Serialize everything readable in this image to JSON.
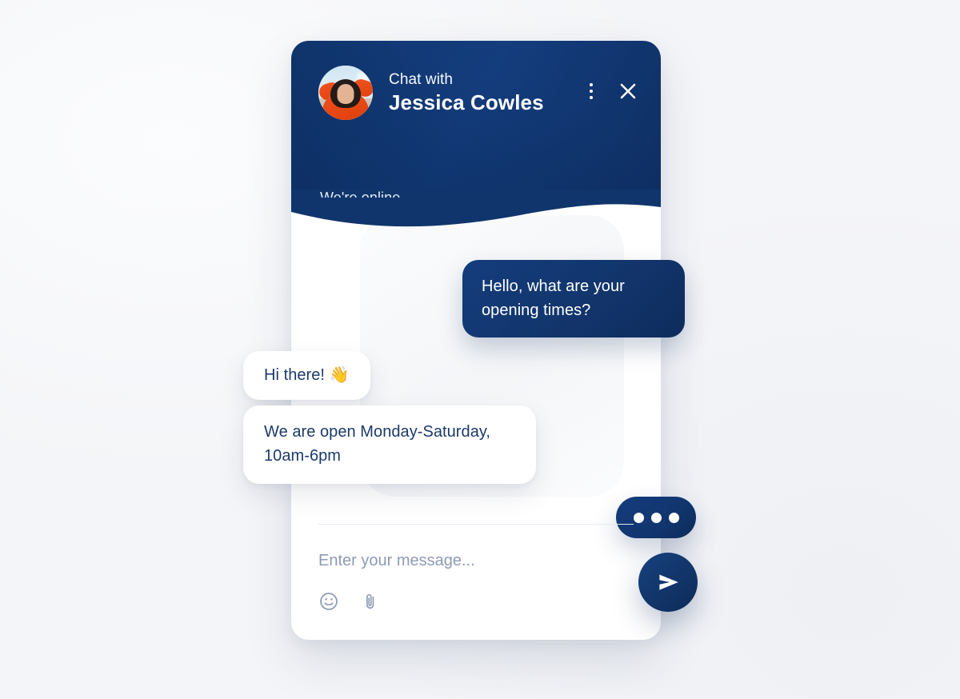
{
  "theme": {
    "page_background": "#f4f5f8",
    "brand_navy": "#143d7d",
    "brand_navy_dark": "#0d2b59",
    "agent_text": "#1c3a6b",
    "muted_text": "#8d9ab4",
    "bubble_white": "#ffffff"
  },
  "header": {
    "chat_with_label": "Chat with",
    "agent_name": "Jessica Cowles",
    "status": "We're online",
    "avatar_alt": "agent-photo",
    "menu_icon": "kebab-menu-icon",
    "close_icon": "close-icon"
  },
  "messages": [
    {
      "id": "m1",
      "sender": "user",
      "text": "Hello, what are your opening times?"
    },
    {
      "id": "m2",
      "sender": "agent",
      "text": "Hi there! ",
      "emoji": "👋"
    },
    {
      "id": "m3",
      "sender": "agent",
      "text": "We are open Monday-Saturday, 10am-6pm"
    }
  ],
  "typing_indicator": {
    "visible": true,
    "dots": 3,
    "label": "typing-indicator"
  },
  "composer": {
    "placeholder": "Enter your message...",
    "value": "",
    "emoji_button": "emoji-icon",
    "attachment_button": "paperclip-icon",
    "send_button": "send-icon"
  }
}
